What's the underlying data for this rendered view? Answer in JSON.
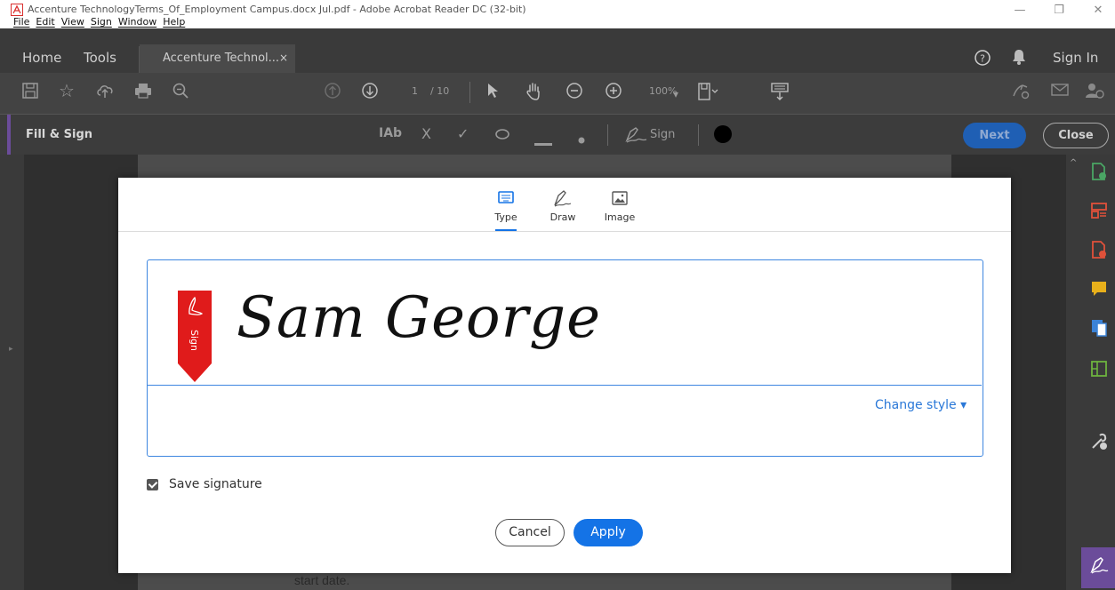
{
  "window": {
    "title": "Accenture TechnologyTerms_Of_Employment Campus.docx  Jul.pdf - Adobe Acrobat Reader DC (32-bit)",
    "minimize": "—",
    "maximize": "❐",
    "close": "✕"
  },
  "menu": [
    "File",
    "Edit",
    "View",
    "Sign",
    "Window",
    "Help"
  ],
  "tabs": {
    "home": "Home",
    "tools": "Tools",
    "document": "Accenture Technol...",
    "document_close": "×",
    "sign_in": "Sign In"
  },
  "toolbar": {
    "page_current": "1",
    "page_total": "/ 10",
    "zoom": "100%"
  },
  "fill_sign": {
    "label": "Fill & Sign",
    "text_tool": "IAb",
    "cross_tool": "X",
    "check_tool": "✓",
    "sign_label": "Sign",
    "next": "Next",
    "close": "Close"
  },
  "document": {
    "visible_text": "start date."
  },
  "dialog": {
    "tabs": [
      {
        "label": "Type"
      },
      {
        "label": "Draw"
      },
      {
        "label": "Image"
      }
    ],
    "ribbon_label": "Sign",
    "signature_text": "Sam George",
    "change_style": "Change style ▾",
    "save_signature": "Save signature",
    "cancel": "Cancel",
    "apply": "Apply"
  },
  "colors": {
    "accent_blue": "#1473e6",
    "ribbon_red": "#e01b1b",
    "fill_sign_purple": "#6b4c9a"
  }
}
